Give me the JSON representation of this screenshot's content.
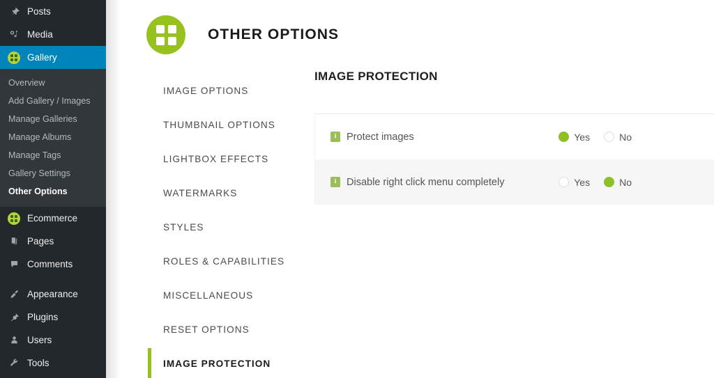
{
  "sidebar": {
    "items": [
      {
        "label": "Posts",
        "icon": "pin-icon",
        "active": false
      },
      {
        "label": "Media",
        "icon": "media-icon",
        "active": false
      },
      {
        "label": "Gallery",
        "icon": "gallery-grid-icon",
        "active": true
      }
    ],
    "submenu": [
      {
        "label": "Overview",
        "current": false
      },
      {
        "label": "Add Gallery / Images",
        "current": false
      },
      {
        "label": "Manage Galleries",
        "current": false
      },
      {
        "label": "Manage Albums",
        "current": false
      },
      {
        "label": "Manage Tags",
        "current": false
      },
      {
        "label": "Gallery Settings",
        "current": false
      },
      {
        "label": "Other Options",
        "current": true
      }
    ],
    "items_lower": [
      {
        "label": "Ecommerce",
        "icon": "ecommerce-grid-icon"
      },
      {
        "label": "Pages",
        "icon": "pages-icon"
      },
      {
        "label": "Comments",
        "icon": "comments-icon"
      }
    ],
    "items_bottom": [
      {
        "label": "Appearance",
        "icon": "brush-icon"
      },
      {
        "label": "Plugins",
        "icon": "plug-icon"
      },
      {
        "label": "Users",
        "icon": "user-icon"
      },
      {
        "label": "Tools",
        "icon": "wrench-icon"
      }
    ],
    "colors": {
      "background": "#23282d",
      "submenu_background": "#32373c",
      "active_background": "#0085ba",
      "badge_green": "#b6d33a"
    }
  },
  "header": {
    "title": "OTHER OPTIONS",
    "icon": "grid-four-squares-icon",
    "badge_color": "#97c11f"
  },
  "tabs": [
    {
      "label": "IMAGE OPTIONS",
      "active": false
    },
    {
      "label": "THUMBNAIL OPTIONS",
      "active": false
    },
    {
      "label": "LIGHTBOX EFFECTS",
      "active": false
    },
    {
      "label": "WATERMARKS",
      "active": false
    },
    {
      "label": "STYLES",
      "active": false
    },
    {
      "label": "ROLES & CAPABILITIES",
      "active": false
    },
    {
      "label": "MISCELLANEOUS",
      "active": false
    },
    {
      "label": "RESET OPTIONS",
      "active": false
    },
    {
      "label": "IMAGE PROTECTION",
      "active": true
    }
  ],
  "panel": {
    "title": "IMAGE PROTECTION",
    "accent_color": "#97c11f",
    "rows": [
      {
        "label": "Protect images",
        "info_icon": "info-icon",
        "options": [
          {
            "text": "Yes",
            "checked": true
          },
          {
            "text": "No",
            "checked": false
          }
        ]
      },
      {
        "label": "Disable right click menu completely",
        "info_icon": "info-icon",
        "options": [
          {
            "text": "Yes",
            "checked": false
          },
          {
            "text": "No",
            "checked": true
          }
        ]
      }
    ]
  }
}
